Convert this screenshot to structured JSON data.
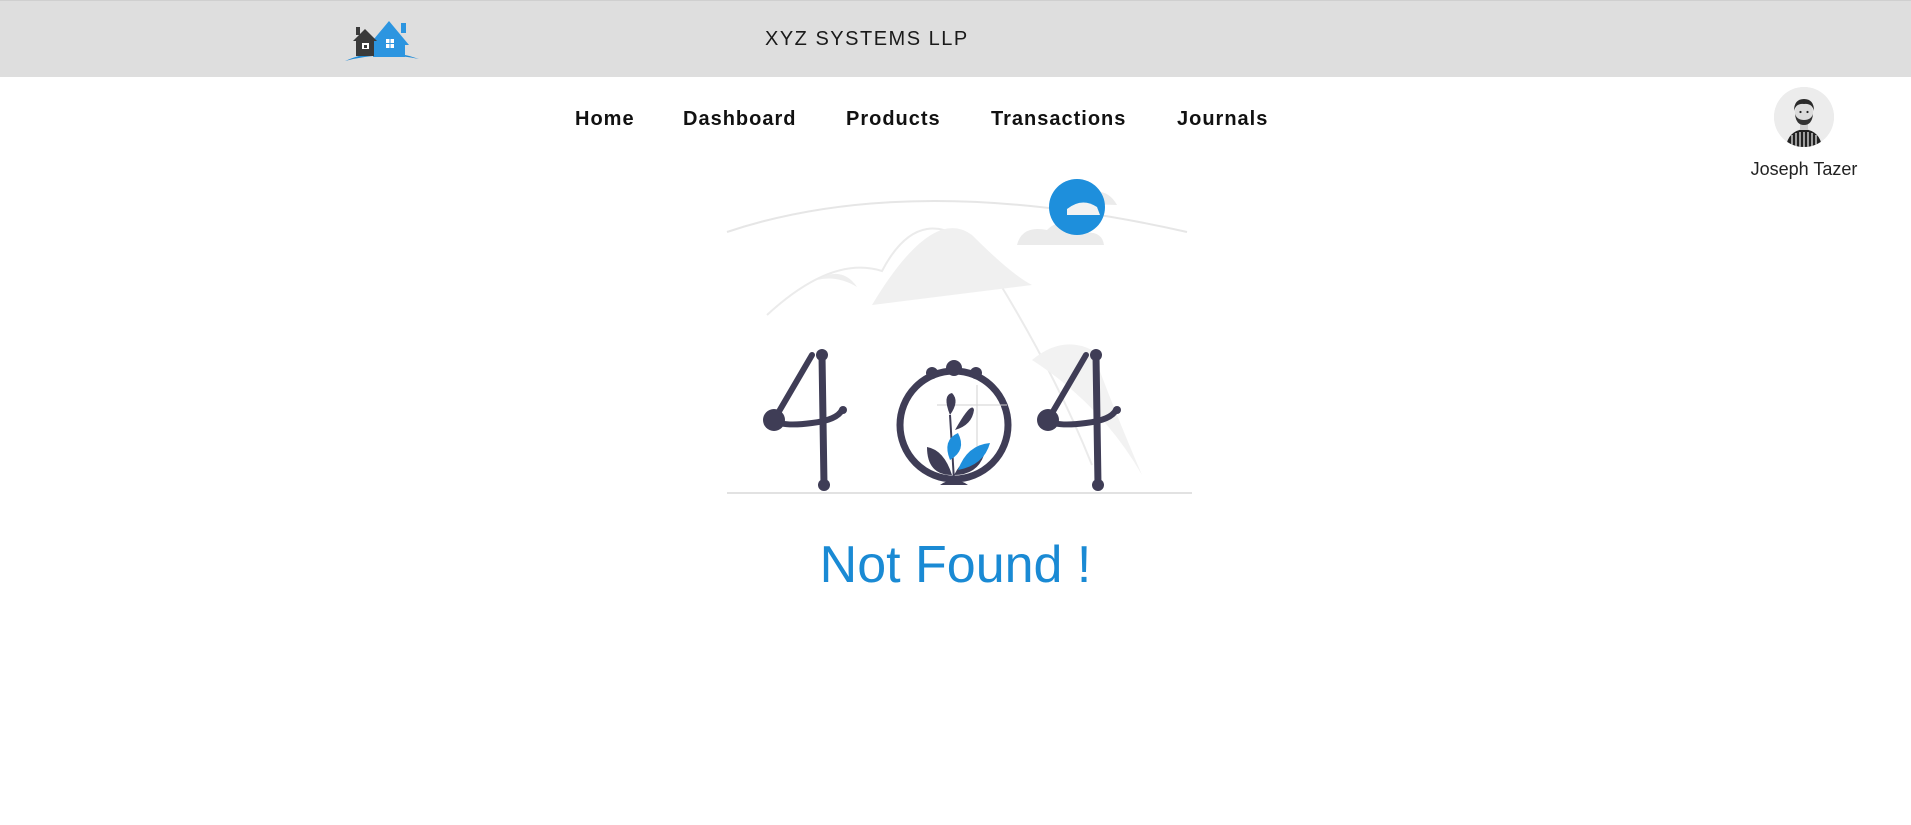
{
  "header": {
    "company_name": "XYZ SYSTEMS LLP",
    "logo_icon": "house-logo-icon"
  },
  "nav": {
    "items": [
      {
        "label": "Home"
      },
      {
        "label": "Dashboard"
      },
      {
        "label": "Products"
      },
      {
        "label": "Transactions"
      },
      {
        "label": "Journals"
      }
    ]
  },
  "user": {
    "name": "Joseph Tazer",
    "avatar_icon": "user-avatar"
  },
  "main": {
    "illustration": "404-illustration",
    "message": "Not Found !"
  },
  "colors": {
    "accent": "#1a8ad4",
    "topbar_bg": "#dedede",
    "dark": "#3f3d56"
  }
}
